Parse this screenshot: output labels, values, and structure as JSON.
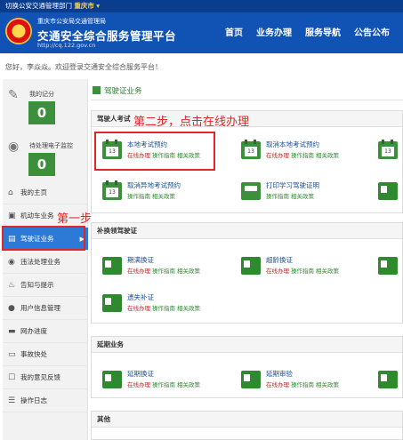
{
  "topbar": {
    "label": "切换公安交通管理部门",
    "city": "重庆市"
  },
  "header": {
    "sub_title": "重庆市公安局交通管理局",
    "main_title": "交通安全综合服务管理平台",
    "url": "http://cq.122.gov.cn",
    "nav": [
      "首页",
      "业务办理",
      "服务导航",
      "公告公布"
    ]
  },
  "greeting": "您好，李焱焱。欢迎登录交通安全综合服务平台！",
  "sidebar": {
    "stats": [
      {
        "label": "我的记分",
        "value": "0",
        "icon": "document-score-icon"
      },
      {
        "label": "待处理电子监控",
        "value": "0",
        "icon": "camera-icon"
      }
    ],
    "items": [
      {
        "label": "我的主页",
        "icon": "home-icon"
      },
      {
        "label": "机动车业务",
        "icon": "truck-icon"
      },
      {
        "label": "驾驶证业务",
        "icon": "license-icon",
        "active": true
      },
      {
        "label": "违法处理业务",
        "icon": "camera-icon"
      },
      {
        "label": "告知与提示",
        "icon": "bell-icon"
      },
      {
        "label": "用户信息管理",
        "icon": "user-icon"
      },
      {
        "label": "网办进度",
        "icon": "progress-icon"
      },
      {
        "label": "事故快处",
        "icon": "accident-icon"
      },
      {
        "label": "我的意见反馈",
        "icon": "feedback-icon"
      },
      {
        "label": "操作日志",
        "icon": "log-icon"
      }
    ]
  },
  "main": {
    "section_title": "驾驶证业务",
    "panels": [
      {
        "title": "驾驶人考试",
        "items": [
          {
            "name": "本地考试预约",
            "links": [
              "在线办理",
              "操作指南",
              "相关政策"
            ]
          },
          {
            "name": "取消本地考试预约",
            "links": [
              "在线办理",
              "操作指南",
              "相关政策"
            ]
          },
          {
            "name": "取消异地考试预约",
            "links": [
              "操作指南",
              "相关政策"
            ]
          },
          {
            "name": "打印学习驾驶证明",
            "links": [
              "操作指南",
              "相关政策"
            ]
          }
        ]
      },
      {
        "title": "补换领驾驶证",
        "items": [
          {
            "name": "期满换证",
            "links": [
              "在线办理",
              "操作指南",
              "相关政策"
            ]
          },
          {
            "name": "超龄换证",
            "links": [
              "在线办理",
              "操作指南",
              "相关政策"
            ]
          },
          {
            "name": "遗失补证",
            "links": [
              "在线办理",
              "操作指南",
              "相关政策"
            ]
          }
        ]
      },
      {
        "title": "延期业务",
        "items": [
          {
            "name": "延期换证",
            "links": [
              "在线办理",
              "操作指南",
              "相关政策"
            ]
          },
          {
            "name": "延期审验",
            "links": [
              "在线办理",
              "操作指南",
              "相关政策"
            ]
          }
        ]
      },
      {
        "title": "其他",
        "items": []
      }
    ],
    "calendar_day": "13"
  },
  "annotations": {
    "step1": "第一步",
    "step2": "第二步，点击在线办理"
  }
}
